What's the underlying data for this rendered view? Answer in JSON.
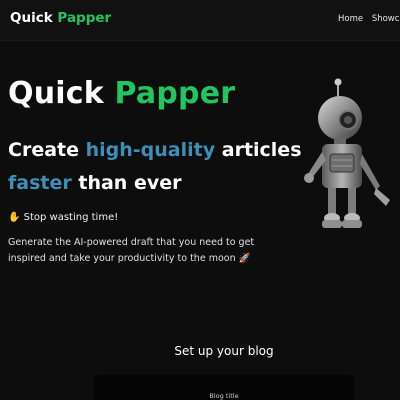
{
  "navbar": {
    "brand_first": "Quick",
    "brand_second": "Papper",
    "links": [
      "Home",
      "Showcase"
    ]
  },
  "hero": {
    "title_first": "Quick",
    "title_second": "Papper",
    "line1_start": "Create",
    "line1_highlight": "high-quality",
    "line1_end": "articles",
    "line2_highlight": "faster",
    "line2_end": "than ever",
    "stop_text": "✋ Stop wasting time!",
    "description": "Generate the AI-powered draft that you need to get inspired and take your productivity to the moon 🚀"
  },
  "setup": {
    "title": "Set up your blog",
    "field_label": "Blog title"
  },
  "colors": {
    "background": "#0d0d0d",
    "navbar": "#111111",
    "accent_green": "#22c55e",
    "accent_blue": "#3d8fb8"
  },
  "icons": {
    "robot": "robot-illustration"
  }
}
